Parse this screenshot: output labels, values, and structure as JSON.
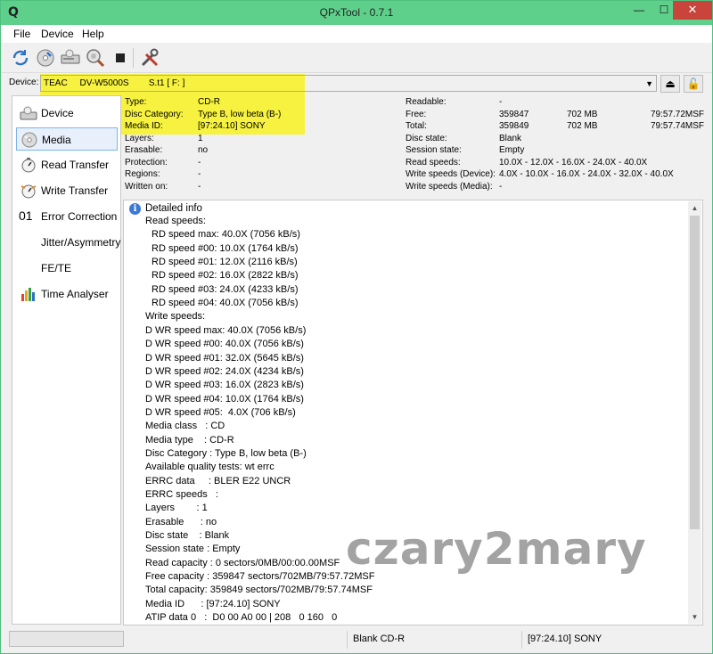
{
  "window": {
    "title": "QPxTool - 0.7.1",
    "icon": "Q"
  },
  "menu": [
    "File",
    "Device",
    "Help"
  ],
  "toolbar": [
    "refresh-icon",
    "disc-scan-icon",
    "drive-icon",
    "zoom-icon",
    "stop-icon",
    "tools-icon"
  ],
  "device": {
    "label": "Device:",
    "value": "TEAC     DV-W5000S        S.t1 [ F: ]",
    "eject": "⏏",
    "lock": "🔓"
  },
  "sidebar": [
    {
      "label": "Device",
      "icon": "drive-icon"
    },
    {
      "label": "Media",
      "icon": "cd-icon"
    },
    {
      "label": "Read Transfer",
      "icon": "read-transfer-icon"
    },
    {
      "label": "Write Transfer",
      "icon": "write-transfer-icon"
    },
    {
      "label": "Error Correction",
      "icon": "error-correction-icon",
      "prefix": "01"
    },
    {
      "label": "Jitter/Asymmetry",
      "icon": ""
    },
    {
      "label": "FE/TE",
      "icon": ""
    },
    {
      "label": "Time Analyser",
      "icon": "chart-icon"
    }
  ],
  "info_left": [
    {
      "k": "Type:",
      "v": "CD-R"
    },
    {
      "k": "Disc Category:",
      "v": "Type B, low beta (B-)"
    },
    {
      "k": "Media ID:",
      "v": "[97:24.10] SONY"
    },
    {
      "k": "Layers:",
      "v": "1"
    },
    {
      "k": "Erasable:",
      "v": "no"
    },
    {
      "k": "Protection:",
      "v": "-"
    },
    {
      "k": "Regions:",
      "v": "-"
    },
    {
      "k": "Written on:",
      "v": "-"
    }
  ],
  "info_right": [
    {
      "k": "Readable:",
      "v": "-",
      "mb": "",
      "msf": ""
    },
    {
      "k": "Free:",
      "v": "359847",
      "mb": "702 MB",
      "msf": "79:57.72MSF"
    },
    {
      "k": "Total:",
      "v": "359849",
      "mb": "702 MB",
      "msf": "79:57.74MSF"
    },
    {
      "k": "Disc state:",
      "v": "Blank",
      "mb": "",
      "msf": ""
    },
    {
      "k": "Session state:",
      "v": "Empty",
      "mb": "",
      "msf": ""
    },
    {
      "k": "Read speeds:",
      "v": "10.0X - 12.0X - 16.0X - 24.0X - 40.0X",
      "mb": "",
      "msf": ""
    },
    {
      "k": "Write speeds (Device):",
      "v": "4.0X - 10.0X - 16.0X - 24.0X - 32.0X - 40.0X",
      "mb": "",
      "msf": ""
    },
    {
      "k": "Write speeds (Media):",
      "v": "-",
      "mb": "",
      "msf": ""
    }
  ],
  "detail": {
    "header": "Detailed info",
    "lines": [
      {
        "t": "Read speeds:",
        "i": 0
      },
      {
        "t": "RD speed max: 40.0X (7056 kB/s)",
        "i": 1
      },
      {
        "t": "RD speed #00: 10.0X (1764 kB/s)",
        "i": 1
      },
      {
        "t": "RD speed #01: 12.0X (2116 kB/s)",
        "i": 1
      },
      {
        "t": "RD speed #02: 16.0X (2822 kB/s)",
        "i": 1
      },
      {
        "t": "RD speed #03: 24.0X (4233 kB/s)",
        "i": 1
      },
      {
        "t": "RD speed #04: 40.0X (7056 kB/s)",
        "i": 1
      },
      {
        "t": "Write speeds:",
        "i": 0
      },
      {
        "t": "D WR speed max: 40.0X (7056 kB/s)",
        "i": 0
      },
      {
        "t": "D WR speed #00: 40.0X (7056 kB/s)",
        "i": 0
      },
      {
        "t": "D WR speed #01: 32.0X (5645 kB/s)",
        "i": 0
      },
      {
        "t": "D WR speed #02: 24.0X (4234 kB/s)",
        "i": 0
      },
      {
        "t": "D WR speed #03: 16.0X (2823 kB/s)",
        "i": 0
      },
      {
        "t": "D WR speed #04: 10.0X (1764 kB/s)",
        "i": 0
      },
      {
        "t": "D WR speed #05:  4.0X (706 kB/s)",
        "i": 0
      },
      {
        "t": "Media class   : CD",
        "i": 0
      },
      {
        "t": "Media type    : CD-R",
        "i": 0
      },
      {
        "t": "Disc Category : Type B, low beta (B-)",
        "i": 0
      },
      {
        "t": "Available quality tests: wt errc",
        "i": 0
      },
      {
        "t": "ERRC data     : BLER E22 UNCR",
        "i": 0
      },
      {
        "t": "ERRC speeds   :",
        "i": 0
      },
      {
        "t": "Layers        : 1",
        "i": 0
      },
      {
        "t": "Erasable      : no",
        "i": 0
      },
      {
        "t": "Disc state    : Blank",
        "i": 0
      },
      {
        "t": "Session state : Empty",
        "i": 0
      },
      {
        "t": "Read capacity : 0 sectors/0MB/00:00.00MSF",
        "i": 0
      },
      {
        "t": "Free capacity : 359847 sectors/702MB/79:57.72MSF",
        "i": 0
      },
      {
        "t": "Total capacity: 359849 sectors/702MB/79:57.74MSF",
        "i": 0
      },
      {
        "t": "Media ID      : [97:24.10] SONY",
        "i": 0
      },
      {
        "t": "ATIP data 0   :  D0 00 A0 00 | 208   0 160   0",
        "i": 0
      }
    ]
  },
  "watermark": "czary2mary",
  "status": {
    "media": "Blank CD-R",
    "media_id": "[97:24.10] SONY"
  }
}
